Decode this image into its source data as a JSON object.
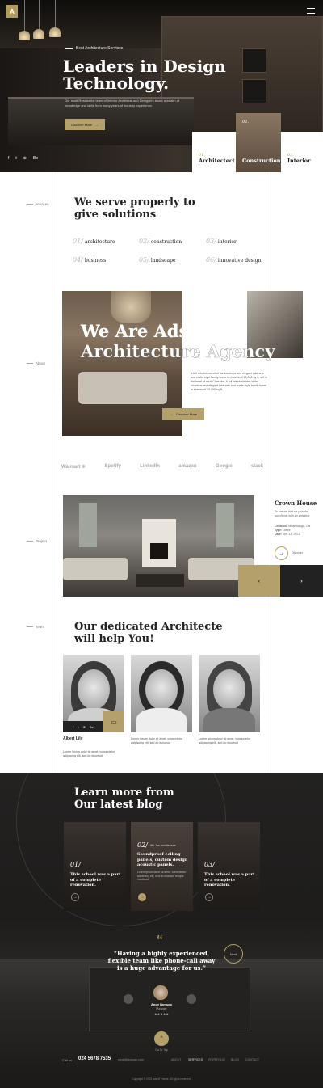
{
  "hero": {
    "tagline": "Best Architecture Services",
    "title_line1": "Leaders in Design",
    "title_line2": "Technology.",
    "description": "Our multi-Residential team of Interior Architects and Designers boast a wealth of knowledge and skills from many years of industry experience.",
    "cta": "Discover More",
    "social": [
      "f",
      "t",
      "⊕",
      "Be"
    ],
    "categories": [
      {
        "num": "01.",
        "label": "Architectect"
      },
      {
        "num": "02.",
        "label": "Construction"
      },
      {
        "num": "03.",
        "label": "Interior"
      }
    ]
  },
  "services": {
    "side_label": "services",
    "title_line1": "We serve properly to",
    "title_line2": "give solutions",
    "items": [
      {
        "num": "01/",
        "label": "architecture"
      },
      {
        "num": "02/",
        "label": "construction"
      },
      {
        "num": "03/",
        "label": "interior"
      },
      {
        "num": "04/",
        "label": "business"
      },
      {
        "num": "05/",
        "label": "landscape"
      },
      {
        "num": "06/",
        "label": "innovative design"
      }
    ]
  },
  "about": {
    "side_label": "About",
    "title_line1": "We Are Adsett",
    "title_line2": "Architecture Agency",
    "text": "A full refurbishment of the luxurious and elegant lake arts and crafts style family home in excess of 10,000 sq ft, set in the heart of rural Cheshire. A full refurbishment of the luxurious and elegant lake arts and crafts style family home in excess of 10,000 sq ft.",
    "cta": "Discover More"
  },
  "brands": [
    "Walmart ✳",
    "Spotify",
    "LinkedIn",
    "amazon",
    "Google",
    "slack"
  ],
  "project": {
    "side_label": "Project",
    "title": "Crown House",
    "intro": "To ensure that we provide our clients with an amazing",
    "location_label": "Location:",
    "location": "Mississauga, ON",
    "type_label": "Type:",
    "type": "Office",
    "date_label": "Date:",
    "date": "July 13, 2021",
    "discover": "Discover",
    "prev": "‹",
    "next": "›"
  },
  "team": {
    "side_label": "Team",
    "title_line1": "Our dedicated Architecte",
    "title_line2": "will help You!",
    "members": [
      {
        "name": "Albert Lily",
        "text": "Lorem ipsum dolor sit amet, consectetur adipiscing elit, sed do eiusmod"
      },
      {
        "name": "",
        "text": "Lorem ipsum dolor sit amet, consectetur adipiscing elit, sed do eiusmod"
      },
      {
        "name": "",
        "text": "Lorem ipsum dolor sit amet, consectetur adipiscing elit, sed do eiusmod"
      }
    ]
  },
  "blog": {
    "title_line1": "Learn more from",
    "title_line2": "Our latest blog",
    "posts": [
      {
        "num": "01/",
        "title": "This school was a part of a complete renovation.",
        "meta": "",
        "excerpt": ""
      },
      {
        "num": "02/",
        "title": "Soundproof ceiling panels, custom design acoustic panels.",
        "meta": "5th Jan   Architecture",
        "excerpt": "Lorem ipsum dolor sit amet, consectetur adipiscing elit, sed do eiusmod tempor incididunt"
      },
      {
        "num": "03/",
        "title": "This school was a part of a complete renovation.",
        "meta": "",
        "excerpt": ""
      }
    ]
  },
  "testimonial": {
    "quote": "“Having a highly experienced, flexible team like phone-call away is a huge advantage for us.”",
    "next": "Next",
    "name": "Andy Bonsoo",
    "role": "Manager",
    "stars": "★★★★★"
  },
  "footer": {
    "top_label": "Go To Top",
    "call_label": "Call us",
    "phone": "024 5678 7535",
    "email": "email@domain.com",
    "links": [
      "ABOUT",
      "SERVICES",
      "PORTFOLIO",
      "BLOG",
      "CONTACT"
    ],
    "copyright": "Copyright © 2022 adsett Theme. All rights reserved."
  },
  "colors": {
    "accent": "#b3a06a",
    "dark": "#1e1d1c"
  }
}
